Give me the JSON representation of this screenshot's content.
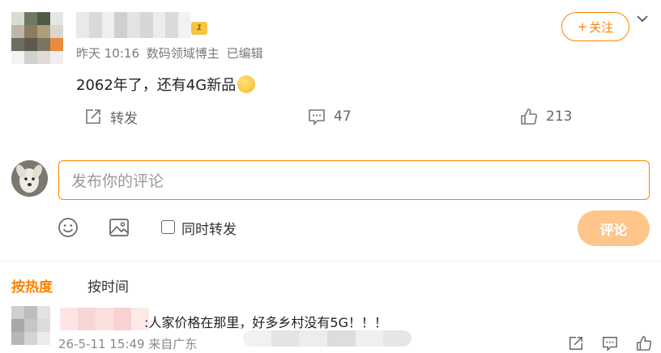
{
  "post": {
    "author_level": "1",
    "follow_label": "关注",
    "follow_prefix": "+",
    "meta": {
      "time": "昨天 10:16",
      "source": "数码领域博主",
      "edited": "已编辑"
    },
    "text": "2062年了，还有4G新品",
    "emoji_icon": "thinking-face-emoji",
    "actions": {
      "repost_label": "转发",
      "comment_count": "47",
      "like_count": "213"
    }
  },
  "composer": {
    "placeholder": "发布你的评论",
    "repost_checkbox_label": "同时转发",
    "submit_label": "评论"
  },
  "sort": {
    "hot_label": "按热度",
    "time_label": "按时间"
  },
  "comments": [
    {
      "text": ":人家价格在那里，好多乡村没有5G！！！",
      "meta": "26-5-11 15:49 来自广东"
    }
  ],
  "colors": {
    "accent": "#ff8200",
    "submit_disabled": "#ffc58a"
  }
}
